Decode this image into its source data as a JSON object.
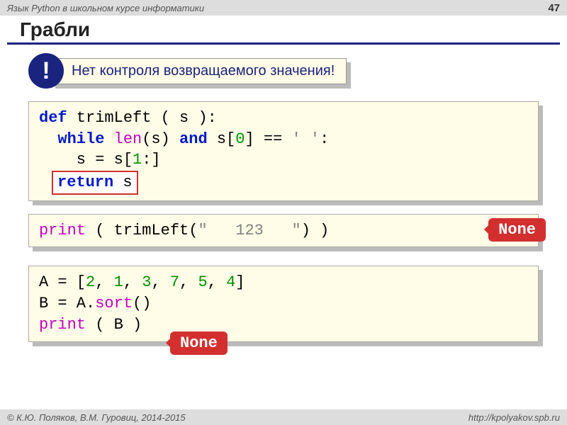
{
  "header": {
    "left": "Язык Python в школьном курсе информатики",
    "page": "47"
  },
  "title": "Грабли",
  "warning": {
    "mark": "!",
    "text": "Нет контроля возвращаемого значения!"
  },
  "code1": {
    "l1_def": "def",
    "l1_name": " trimLeft ( s ):",
    "l2_while": "while",
    "l2_len": "len",
    "l2_mid1": "(s) ",
    "l2_and": "and",
    "l2_mid2": " s[",
    "l2_zero": "0",
    "l2_mid3": "] == ",
    "l2_str": "' '",
    "l2_end": ":",
    "l3_a": "    s = s[",
    "l3_one": "1",
    "l3_b": ":]",
    "ret_kw": "return",
    "ret_rest": " s"
  },
  "code2": {
    "print": "print",
    "mid": " ( trimLeft(",
    "str": "\"   123   \"",
    "end": ") )",
    "callout": "None"
  },
  "code3": {
    "l1_a": "A = [",
    "l1_nums": [
      "2",
      "1",
      "3",
      "7",
      "5",
      "4"
    ],
    "l1_sep": ", ",
    "l1_b": "]",
    "l2_a": "B = A.",
    "l2_sort": "sort",
    "l2_b": "()",
    "l3_print": "print",
    "l3_rest": " ( B )",
    "callout": "None"
  },
  "footer": {
    "left": "© К.Ю. Поляков, В.М. Гуровиц, 2014-2015",
    "right": "http://kpolyakov.spb.ru"
  }
}
